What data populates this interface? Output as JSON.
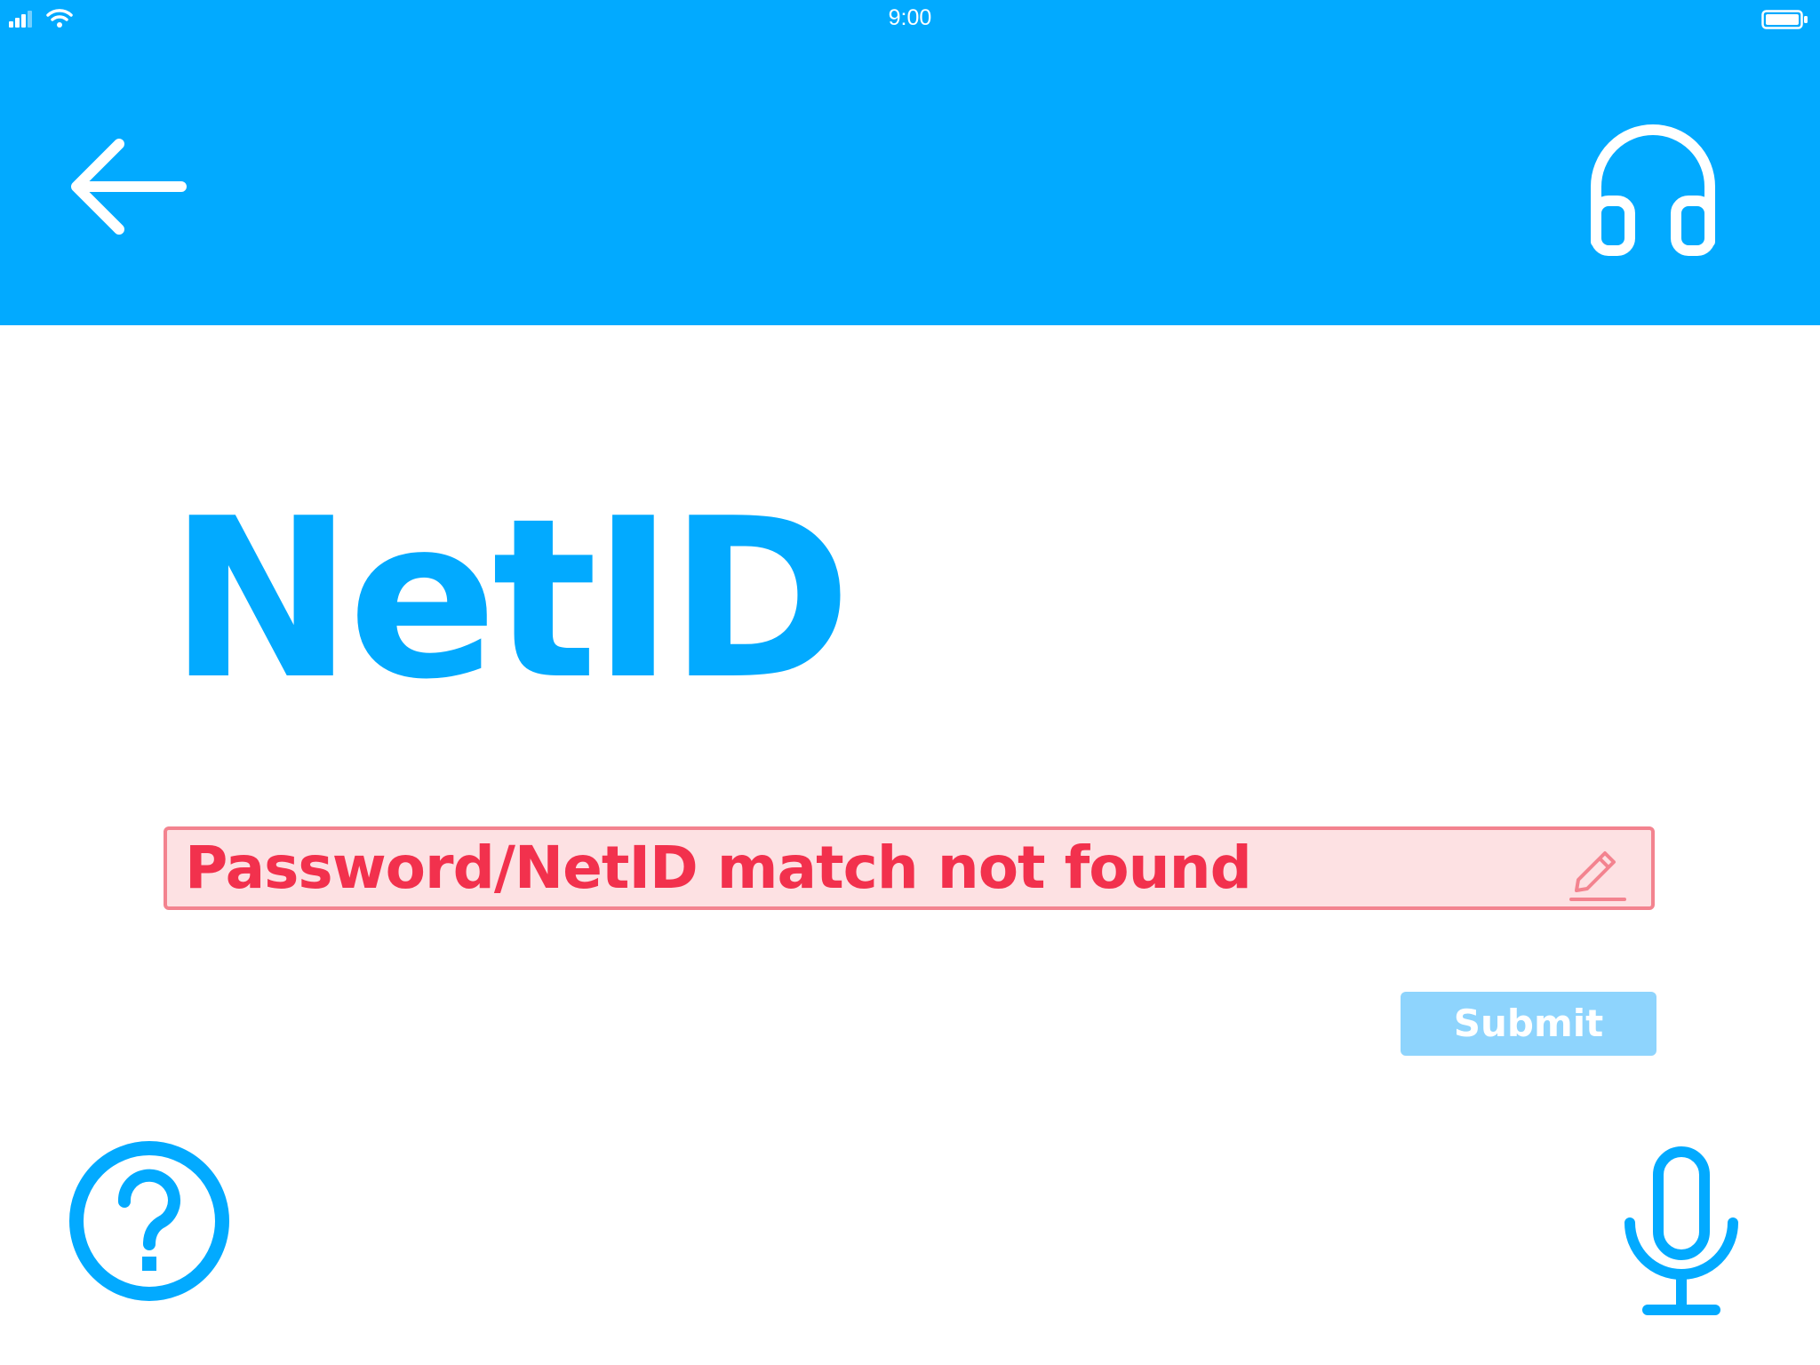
{
  "status_bar": {
    "time": "9:00",
    "signal_icon": "signal-bars-icon",
    "wifi_icon": "wifi-icon",
    "battery_icon": "battery-icon"
  },
  "header": {
    "background_color": "#02AAFF",
    "back_icon": "arrow-left-icon",
    "support_icon": "headphones-icon"
  },
  "main": {
    "title": "NetID",
    "title_color": "#02AAFF",
    "netid_field": {
      "value": "Password/NetID match not found",
      "state": "error",
      "text_color": "#F2314D",
      "border_color": "#F3838F",
      "background_color": "#FDE1E3",
      "edit_icon": "pencil-icon"
    },
    "submit_label": "Submit",
    "submit_color": "#8ED4FD"
  },
  "footer": {
    "help_icon": "question-circle-icon",
    "mic_icon": "microphone-icon"
  }
}
